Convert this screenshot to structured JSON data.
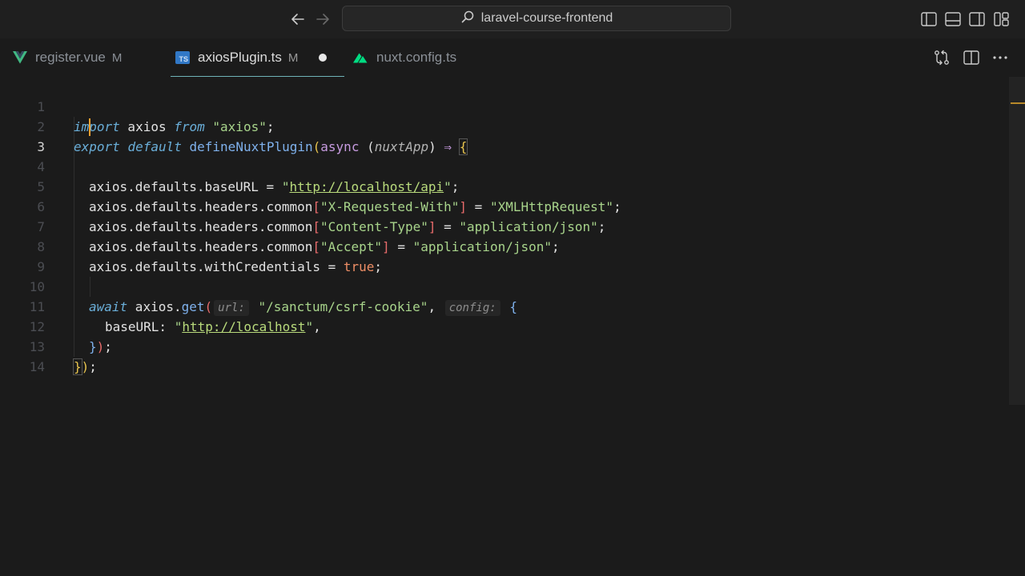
{
  "window": {
    "search_text": "laravel-course-frontend"
  },
  "tabs": [
    {
      "name": "register.vue",
      "modified": "M",
      "icon": "vue-icon",
      "active": false
    },
    {
      "name": "axiosPlugin.ts",
      "modified": "M",
      "icon": "typescript-icon",
      "active": true,
      "dirty": true,
      "badge": "TS"
    },
    {
      "name": "nuxt.config.ts",
      "modified": "",
      "icon": "nuxt-icon",
      "active": false
    }
  ],
  "editor": {
    "current_line": 3,
    "line_numbers": [
      "1",
      "2",
      "3",
      "4",
      "5",
      "6",
      "7",
      "8",
      "9",
      "10",
      "11",
      "12",
      "13",
      "14"
    ],
    "lines": {
      "l1": {
        "t1": "import",
        "t2": " axios ",
        "t3": "from",
        "t4": " ",
        "t5": "\"axios\"",
        "t6": ";"
      },
      "l2": {
        "t1": "export",
        "t2": " ",
        "t3": "default",
        "t4": " ",
        "t5": "defineNuxtPlugin",
        "t6": "(",
        "t7": "async",
        "t8": " (",
        "t9": "nuxtApp",
        "t10": ") ",
        "t11": "⇒",
        "t12": " ",
        "t13": "{"
      },
      "l4": {
        "t1": "axios.defaults.baseURL = ",
        "t2": "\"",
        "t3": "http://localhost/api",
        "t4": "\"",
        "t5": ";"
      },
      "l5": {
        "t1": "axios.defaults.headers.common",
        "t2": "[",
        "t3": "\"X-Requested-With\"",
        "t4": "]",
        "t5": " = ",
        "t6": "\"XMLHttpRequest\"",
        "t7": ";"
      },
      "l6": {
        "t1": "axios.defaults.headers.common",
        "t2": "[",
        "t3": "\"Content-Type\"",
        "t4": "]",
        "t5": " = ",
        "t6": "\"application/json\"",
        "t7": ";"
      },
      "l7": {
        "t1": "axios.defaults.headers.common",
        "t2": "[",
        "t3": "\"Accept\"",
        "t4": "]",
        "t5": " = ",
        "t6": "\"application/json\"",
        "t7": ";"
      },
      "l8": {
        "t1": "axios.defaults.withCredentials = ",
        "t2": "true",
        "t3": ";"
      },
      "l10": {
        "t1": "await",
        "t2": " axios.",
        "t3": "get",
        "t4": "(",
        "hint1": "url:",
        "t5": " ",
        "t6": "\"/sanctum/csrf-cookie\"",
        "t7": ", ",
        "hint2": "config:",
        "t8": " ",
        "t9": "{"
      },
      "l11": {
        "t1": "baseURL: ",
        "t2": "\"",
        "t3": "http://localhost",
        "t4": "\"",
        "t5": ","
      },
      "l12": {
        "t1": "}",
        "t2": ")",
        "t3": ";"
      },
      "l13": {
        "t1": "}",
        "t2": ")",
        "t3": ";"
      }
    }
  },
  "colors": {
    "background": "#1b1b1b",
    "keyword_italic": "#6aaed8",
    "string": "#a8d48b",
    "function": "#7fb1ec",
    "cursor": "#f0a030",
    "active_tab_underline": "#6fb3b8"
  }
}
